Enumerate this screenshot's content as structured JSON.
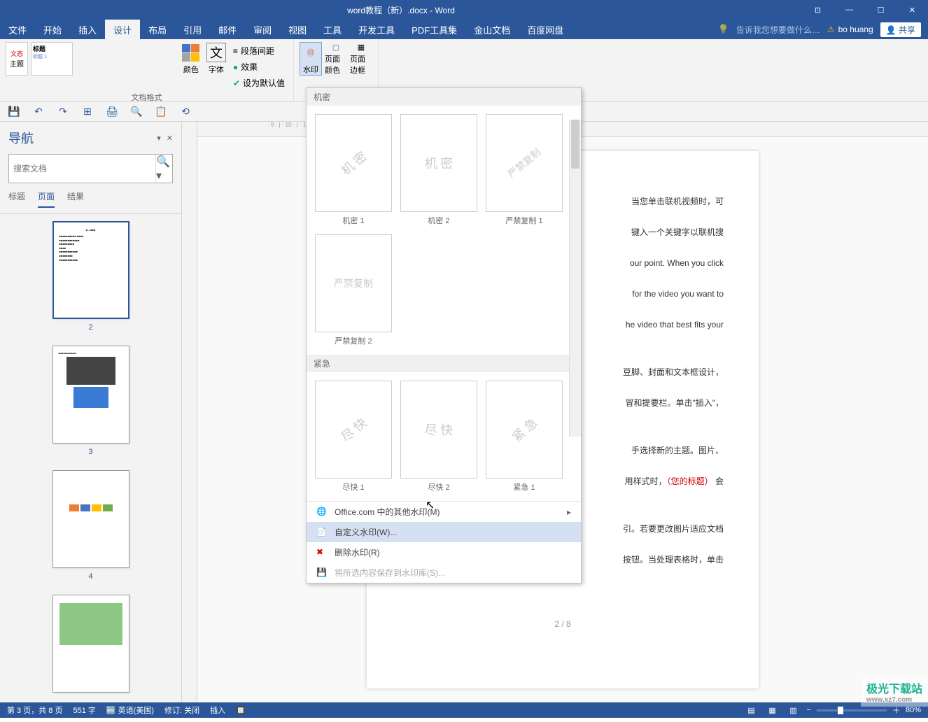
{
  "title": "word教程（新）.docx - Word",
  "window_controls": {
    "min": "—",
    "max": "☐",
    "close": "✕",
    "ribbon_opts": "⊡"
  },
  "menubar": {
    "tabs": [
      "文件",
      "开始",
      "插入",
      "设计",
      "布局",
      "引用",
      "邮件",
      "审阅",
      "视图",
      "工具",
      "开发工具",
      "PDF工具集",
      "金山文档",
      "百度网盘"
    ],
    "active_index": 3,
    "tellme": "告诉我您想要做什么…",
    "user": "bo huang",
    "share": "共享"
  },
  "ribbon": {
    "themes": {
      "btn": "主题",
      "preview_title": "标题",
      "preview_sub": "标题 1",
      "group_label": "文档格式"
    },
    "colors": "颜色",
    "fonts": "字体",
    "para_spacing": "段落间距",
    "effects": "效果",
    "set_default": "设为默认值",
    "watermark": "水印",
    "page_color": "页面颜色",
    "page_border": "页面边框"
  },
  "qat": [
    "💾",
    "↶",
    "↷",
    "⊞",
    "🖨",
    "🔍",
    "📋",
    "⟲"
  ],
  "nav": {
    "title": "导航",
    "search_placeholder": "搜索文档",
    "tabs": [
      "标题",
      "页面",
      "结果"
    ],
    "active_tab": 1,
    "thumbs": [
      {
        "num": "2",
        "active": true
      },
      {
        "num": "3",
        "active": false
      },
      {
        "num": "4",
        "active": false
      },
      {
        "num": "",
        "active": false
      }
    ]
  },
  "doc": {
    "lines": [
      {
        "text": "当您单击联机视频时，可",
        "red": ""
      },
      {
        "text": "键入一个关键字以联机搜",
        "red": ""
      },
      {
        "text": "our point. When you click",
        "red": ""
      },
      {
        "text": "for the video you want to",
        "red": ""
      },
      {
        "text": "he video that best fits your",
        "red": ""
      },
      {
        "text": "豆脚、封面和文本框设计，",
        "red": ""
      },
      {
        "text": "冒和提要栏。单击\"插入\"，",
        "red": ""
      },
      {
        "text": "手选择新的主题。图片、",
        "red": ""
      },
      {
        "text_pre": "用样式时，",
        "red": "（您的标题）",
        "text_post": " 会"
      },
      {
        "text": "引。若要更改图片适应文档",
        "red": ""
      },
      {
        "text": "按钮。当处理表格时，单击",
        "red": ""
      }
    ],
    "pagenum": "2 / 8"
  },
  "watermark_menu": {
    "cat1": "机密",
    "cat2": "紧急",
    "items1": [
      {
        "label": "机密 1",
        "text": "机 密",
        "diag": true
      },
      {
        "label": "机密 2",
        "text": "机 密",
        "diag": false
      },
      {
        "label": "严禁复制 1",
        "text": "严禁复制",
        "diag": true
      },
      {
        "label": "严禁复制 2",
        "text": "严禁复制",
        "diag": false
      }
    ],
    "items2": [
      {
        "label": "尽快 1",
        "text": "尽 快",
        "diag": true
      },
      {
        "label": "尽快 2",
        "text": "尽 快",
        "diag": false
      },
      {
        "label": "紧急 1",
        "text": "紧 急",
        "diag": true
      }
    ],
    "footer": {
      "office": "Office.com 中的其他水印(M)",
      "custom": "自定义水印(W)...",
      "remove": "删除水印(R)",
      "save": "将所选内容保存到水印库(S)..."
    }
  },
  "statusbar": {
    "page": "第 3 页，共 8 页",
    "words": "551 字",
    "lang": "英语(美国)",
    "revise": "修订: 关闭",
    "insert": "插入",
    "zoom": "80%"
  },
  "site_watermark": {
    "name": "极光下载站",
    "url": "www.xz7.com"
  }
}
